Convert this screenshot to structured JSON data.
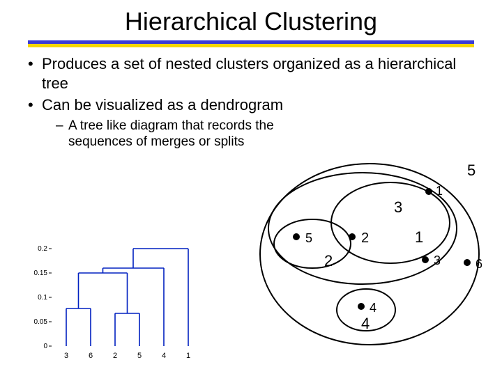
{
  "title": "Hierarchical Clustering",
  "bullet1": "Produces a set of nested clusters organized as a hierarchical tree",
  "bullet2": "Can be visualized as a dendrogram",
  "sub1": "A tree like diagram that records the sequences of merges or splits",
  "chart_data": {
    "type": "line",
    "title": "",
    "xlabel": "",
    "ylabel": "",
    "x_ticks": [
      "3",
      "6",
      "2",
      "5",
      "4",
      "1"
    ],
    "y_ticks": [
      "0",
      "0.05",
      "0.1",
      "0.15",
      "0.2"
    ],
    "ylim": [
      0,
      0.2
    ],
    "cluster_points": [
      "1",
      "2",
      "3",
      "4",
      "5",
      "6"
    ],
    "inner_clusters": [
      "1",
      "2",
      "3",
      "4",
      "5"
    ]
  },
  "venn": {
    "outer": "5",
    "ring3": "3",
    "ring1": "1",
    "ring4": "4",
    "ring2": "2",
    "pt1": "1",
    "pt2": "2",
    "pt3": "3",
    "pt4": "4",
    "pt5": "5",
    "pt6": "6"
  }
}
